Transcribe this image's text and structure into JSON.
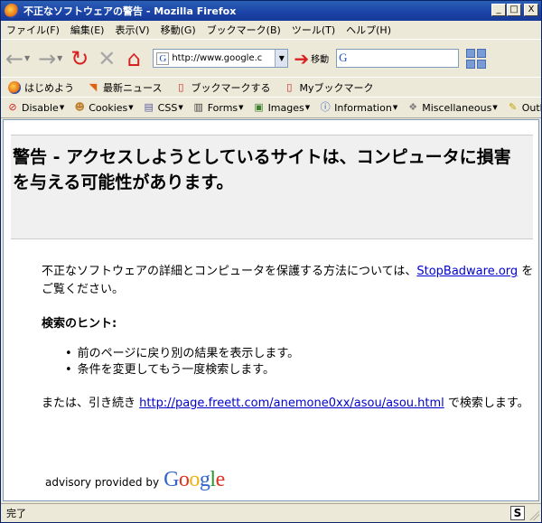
{
  "window": {
    "title": "不正なソフトウェアの警告 - Mozilla Firefox",
    "buttons": {
      "minimize": "_",
      "maximize": "□",
      "close": "X"
    }
  },
  "menu": {
    "items": [
      "ファイル(F)",
      "編集(E)",
      "表示(V)",
      "移動(G)",
      "ブックマーク(B)",
      "ツール(T)",
      "ヘルプ(H)"
    ]
  },
  "nav": {
    "url": "http://www.google.c",
    "url_favicon": "G",
    "go_label": "移動",
    "search_engine": "G"
  },
  "bookmarks": {
    "items": [
      "はじめよう",
      "最新ニュース",
      "ブックマークする",
      "Myブックマーク"
    ]
  },
  "devbar": {
    "items": [
      "Disable",
      "Cookies",
      "CSS",
      "Forms",
      "Images",
      "Information",
      "Miscellaneous",
      "Outl"
    ]
  },
  "content": {
    "warning_title": "警告 - アクセスしようとしているサイトは、コンピュータに損害を与える可能性があります。",
    "intro_before": " 不正なソフトウェアの詳細とコンピュータを保護する方法については、",
    "intro_link": "StopBadware.org",
    "intro_after": " をご覧ください。",
    "hint_title": "検索のヒント:",
    "hints": [
      "前のページに戻り別の結果を表示します。",
      "条件を変更してもう一度検索します。"
    ],
    "continue_before": "または、引き続き ",
    "continue_link": "http://page.freett.com/anemone0xx/asou/asou.html",
    "continue_after": " で検索します。",
    "advisory_text": "advisory provided by",
    "google_logo": "Google"
  },
  "status": {
    "text": "完了",
    "icon": "S"
  },
  "colors": {
    "link": "#0000cc",
    "titlebar": "#1b43a8",
    "google_blue": "#3366cc",
    "google_red": "#dd3322",
    "google_yellow": "#eeb211",
    "google_green": "#229933"
  }
}
